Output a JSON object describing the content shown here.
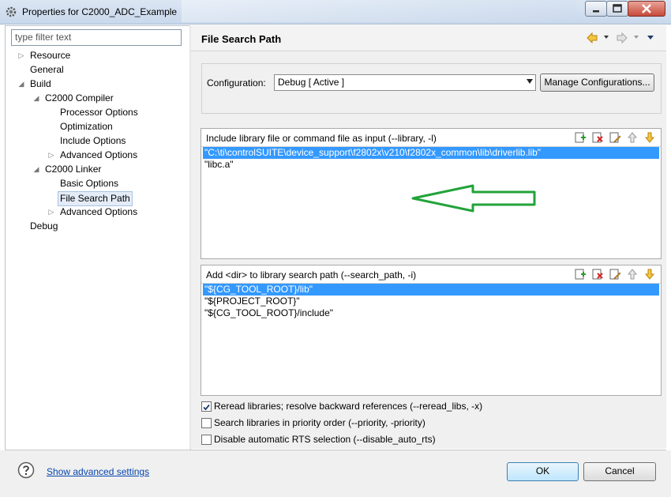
{
  "window": {
    "title": "Properties for C2000_ADC_Example",
    "icon": "gear-icon"
  },
  "filter": {
    "placeholder": "type filter text"
  },
  "tree": [
    {
      "label": "Resource",
      "level": 0,
      "expander": "collapsed"
    },
    {
      "label": "General",
      "level": 0,
      "expander": "none"
    },
    {
      "label": "Build",
      "level": 0,
      "expander": "expanded"
    },
    {
      "label": "C2000 Compiler",
      "level": 1,
      "expander": "expanded"
    },
    {
      "label": "Processor Options",
      "level": 2,
      "expander": "none"
    },
    {
      "label": "Optimization",
      "level": 2,
      "expander": "none"
    },
    {
      "label": "Include Options",
      "level": 2,
      "expander": "none"
    },
    {
      "label": "Advanced Options",
      "level": 2,
      "expander": "collapsed"
    },
    {
      "label": "C2000 Linker",
      "level": 1,
      "expander": "expanded"
    },
    {
      "label": "Basic Options",
      "level": 2,
      "expander": "none"
    },
    {
      "label": "File Search Path",
      "level": 2,
      "expander": "none",
      "selected": true
    },
    {
      "label": "Advanced Options",
      "level": 2,
      "expander": "collapsed"
    },
    {
      "label": "Debug",
      "level": 0,
      "expander": "none"
    }
  ],
  "page": {
    "title": "File Search Path",
    "nav_icons": [
      "back-arrow-icon",
      "forward-arrow-icon",
      "view-menu-icon"
    ]
  },
  "configuration": {
    "label": "Configuration:",
    "value": "Debug  [ Active ]",
    "manage_button": "Manage Configurations..."
  },
  "library_list": {
    "header": "Include library file or command file as input (--library, -l)",
    "items": [
      "\"C:\\ti\\controlSUITE\\device_support\\f2802x\\v210\\f2802x_common\\lib\\driverlib.lib\"",
      "\"libc.a\""
    ],
    "selected_index": 0,
    "tool_icons": [
      "add-icon",
      "delete-icon",
      "edit-icon",
      "move-up-icon",
      "move-down-icon"
    ],
    "annotation": "green-arrow-annotation",
    "annotation_color": "#22a33a"
  },
  "search_path_list": {
    "header": "Add <dir> to library search path (--search_path, -i)",
    "items": [
      "\"${CG_TOOL_ROOT}/lib\"",
      "\"${PROJECT_ROOT}\"",
      "\"${CG_TOOL_ROOT}/include\""
    ],
    "selected_index": 0,
    "tool_icons": [
      "add-icon",
      "delete-icon",
      "edit-icon",
      "move-up-icon",
      "move-down-icon"
    ]
  },
  "checkboxes": [
    {
      "label": "Reread libraries; resolve backward references (--reread_libs, -x)",
      "checked": true
    },
    {
      "label": "Search libraries in priority order (--priority, -priority)",
      "checked": false
    },
    {
      "label": "Disable automatic RTS selection (--disable_auto_rts)",
      "checked": false
    }
  ],
  "footer": {
    "help_icon": "help-icon",
    "advanced_link": "Show advanced settings",
    "ok_button": "OK",
    "cancel_button": "Cancel"
  },
  "colors": {
    "selection": "#3399ff",
    "link": "#0645ad",
    "titlebar": "#c9d8ec"
  }
}
